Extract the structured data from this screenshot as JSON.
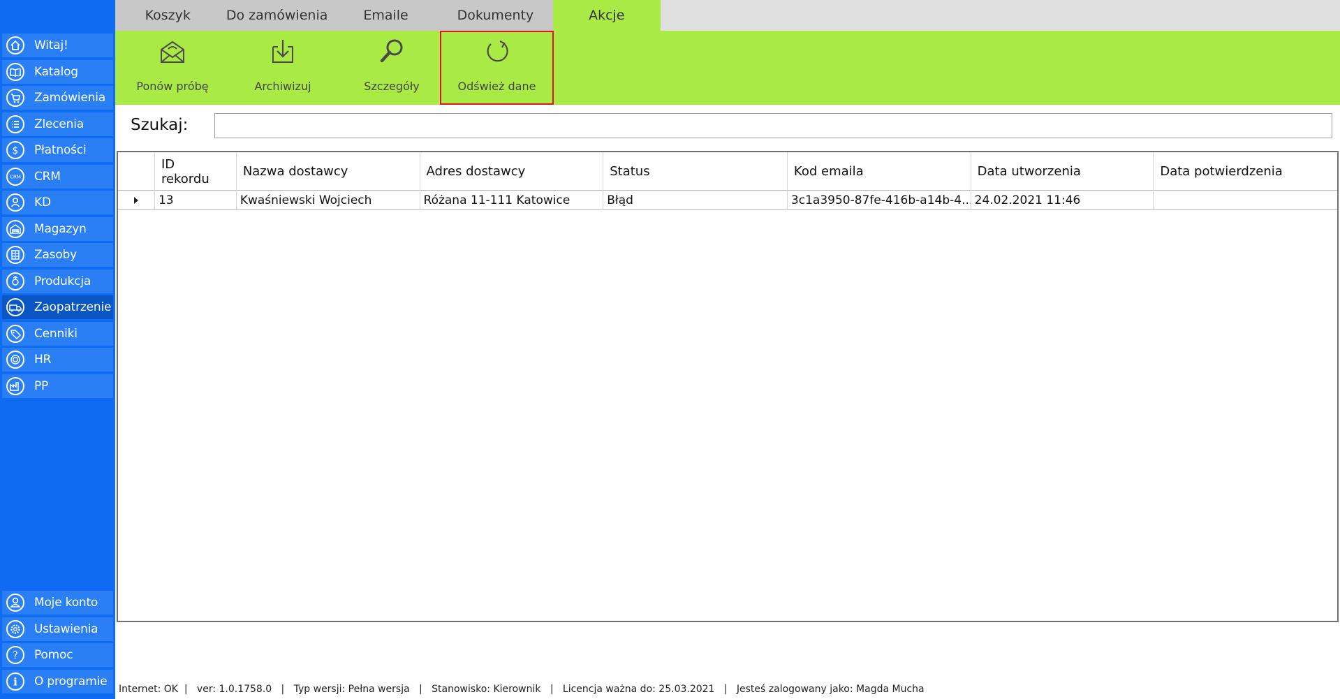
{
  "sidebar": {
    "top_items": [
      {
        "label": "Witaj!",
        "icon": "home-icon"
      },
      {
        "label": "Katalog",
        "icon": "book-icon"
      },
      {
        "label": "Zamówienia",
        "icon": "cart-icon"
      },
      {
        "label": "Zlecenia",
        "icon": "list-icon"
      },
      {
        "label": "Płatności",
        "icon": "dollar-icon"
      },
      {
        "label": "CRM",
        "icon": "crm-icon"
      },
      {
        "label": "KD",
        "icon": "person-icon"
      },
      {
        "label": "Magazyn",
        "icon": "warehouse-icon"
      },
      {
        "label": "Zasoby",
        "icon": "cabinet-icon"
      },
      {
        "label": "Produkcja",
        "icon": "production-icon"
      },
      {
        "label": "Zaopatrzenie",
        "icon": "truck-icon"
      },
      {
        "label": "Cenniki",
        "icon": "tag-icon"
      },
      {
        "label": "HR",
        "icon": "fingerprint-icon"
      },
      {
        "label": "PP",
        "icon": "factory-icon"
      }
    ],
    "bottom_items": [
      {
        "label": "Moje konto",
        "icon": "user-icon"
      },
      {
        "label": "Ustawienia",
        "icon": "gear-icon"
      },
      {
        "label": "Pomoc",
        "icon": "help-icon"
      },
      {
        "label": "O programie",
        "icon": "info-icon"
      }
    ],
    "active": "Zaopatrzenie"
  },
  "tabs": [
    "Koszyk",
    "Do zamówienia",
    "Emaile",
    "Dokumenty",
    "Akcje"
  ],
  "active_tab": "Akcje",
  "toolbar": {
    "buttons": [
      {
        "label": "Ponów próbę",
        "icon": "envelope-retry-icon"
      },
      {
        "label": "Archiwizuj",
        "icon": "archive-icon"
      },
      {
        "label": "Szczegóły",
        "icon": "magnifier-icon"
      },
      {
        "label": "Odśwież dane",
        "icon": "refresh-icon"
      }
    ]
  },
  "search": {
    "label": "Szukaj:",
    "value": ""
  },
  "grid": {
    "columns": [
      "ID\nrekordu",
      "Nazwa dostawcy",
      "Adres dostawcy",
      "Status",
      "Kod emaila",
      "Data utworzenia",
      "Data potwierdzenia"
    ],
    "rows": [
      [
        "13",
        "Kwaśniewski Wojciech",
        "Różana 11-111 Katowice",
        "Błąd",
        "3c1a3950-87fe-416b-a14b-4...",
        "24.02.2021 11:46",
        ""
      ]
    ]
  },
  "statusbar": "Internet: OK  |   ver: 1.0.1758.0   |   Typ wersji: Pełna wersja   |   Stanowisko: Kierownik   |   Licencja ważna do: 25.03.2021   |   Jesteś zalogowany jako: Magda Mucha",
  "colors": {
    "sidebar": "#0f6cf2",
    "toolbar": "#a9ea45",
    "highlight": "#e1141b"
  }
}
